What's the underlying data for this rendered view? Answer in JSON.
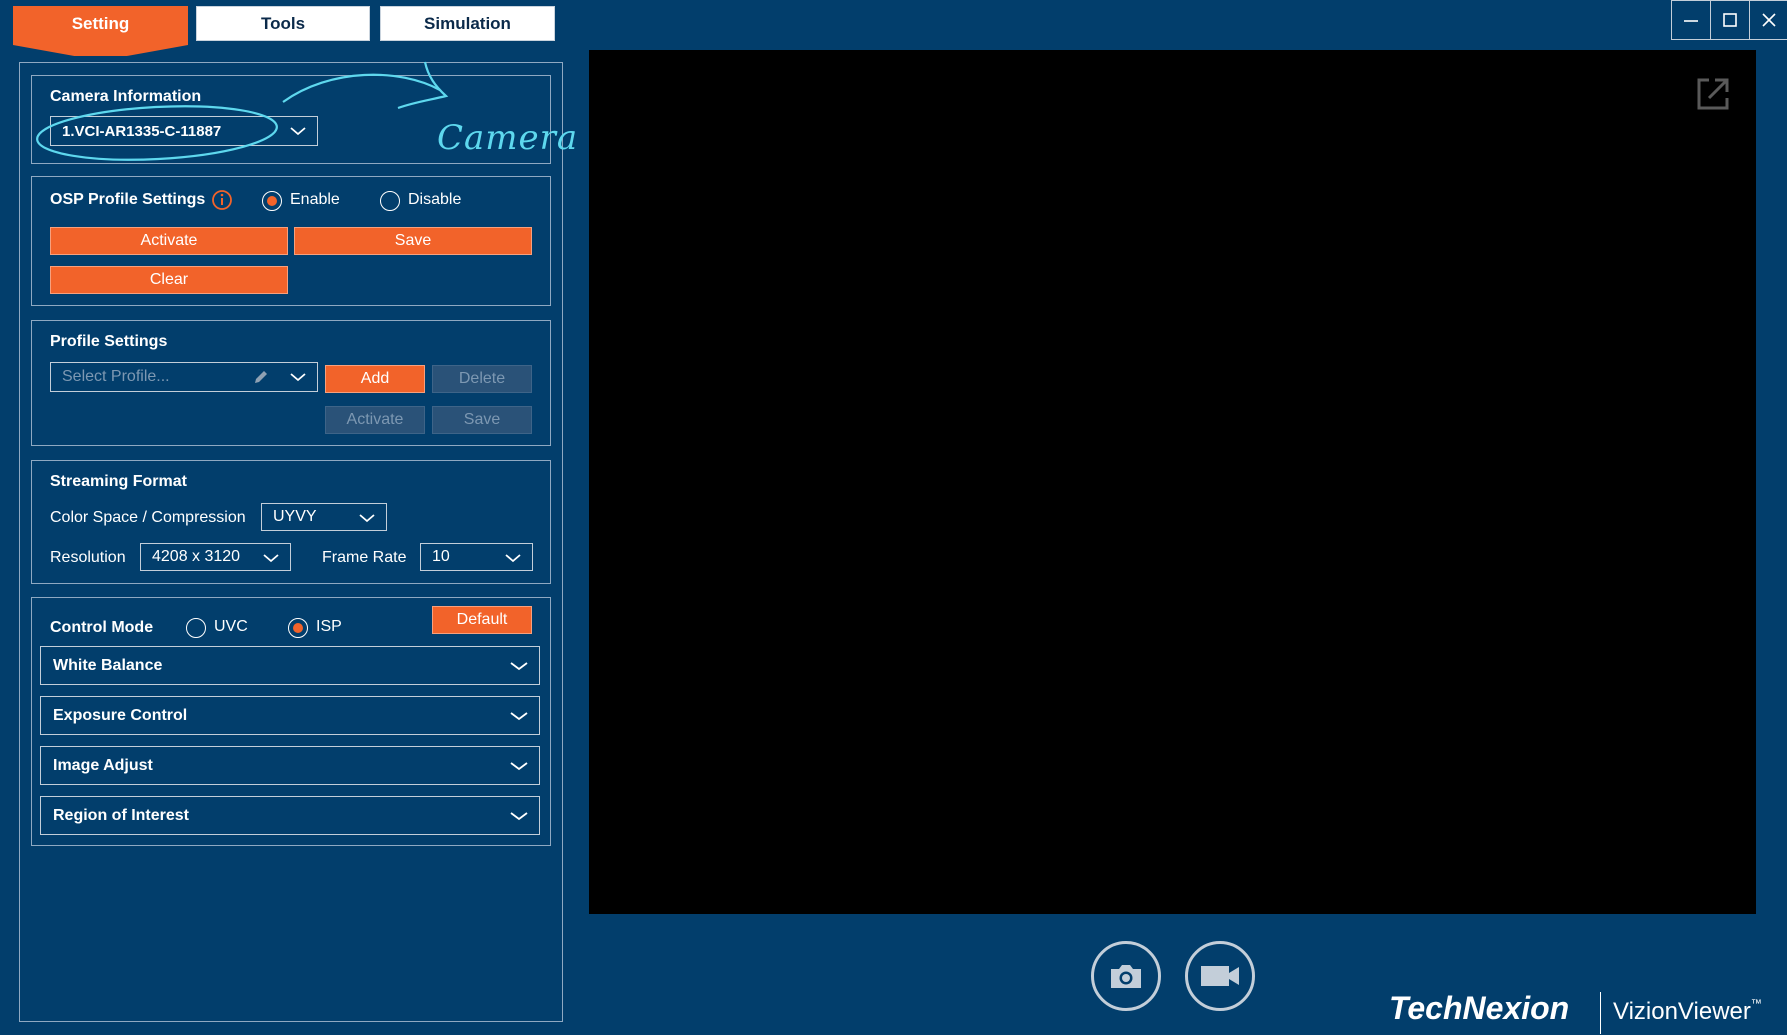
{
  "tabs": [
    {
      "label": "Setting",
      "active": true
    },
    {
      "label": "Tools",
      "active": false
    },
    {
      "label": "Simulation",
      "active": false
    }
  ],
  "window_controls": {
    "minimize": "—",
    "maximize": "☐",
    "close": "✕"
  },
  "camera_info": {
    "title": "Camera Information",
    "device": "1.VCI-AR1335-C-11887",
    "annotation": "Camera Device List"
  },
  "osp": {
    "title": "OSP Profile Settings",
    "enable_label": "Enable",
    "disable_label": "Disable",
    "selected": "Enable",
    "activate_label": "Activate",
    "save_label": "Save",
    "clear_label": "Clear"
  },
  "profile": {
    "title": "Profile Settings",
    "placeholder": "Select Profile...",
    "add_label": "Add",
    "delete_label": "Delete",
    "activate_label": "Activate",
    "save_label": "Save"
  },
  "streaming": {
    "title": "Streaming Format",
    "color_space_label": "Color Space / Compression",
    "color_space_value": "UYVY",
    "resolution_label": "Resolution",
    "resolution_value": "4208 x 3120",
    "frame_rate_label": "Frame Rate",
    "frame_rate_value": "10"
  },
  "control": {
    "title": "Control Mode",
    "uvc_label": "UVC",
    "isp_label": "ISP",
    "selected": "ISP",
    "default_label": "Default",
    "sections": [
      {
        "label": "White Balance"
      },
      {
        "label": "Exposure Control"
      },
      {
        "label": "Image Adjust"
      },
      {
        "label": "Region of Interest"
      }
    ]
  },
  "brand": {
    "company": "TechNexion",
    "product": "VizionViewer",
    "tm": "™"
  },
  "colors": {
    "background": "#023e6c",
    "accent": "#f2632a",
    "annotation": "#5ed8ee"
  }
}
